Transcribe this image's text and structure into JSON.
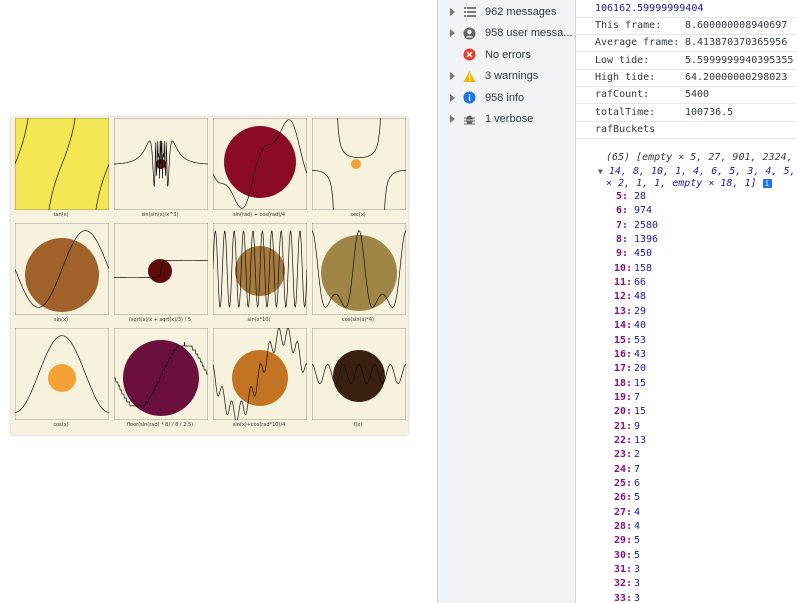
{
  "plots": [
    {
      "caption": "tan(x)",
      "bg": "#f5e654",
      "circle": null
    },
    {
      "caption": "sin(sin(x)/x^3)",
      "bg": "#f6f2dd",
      "circle": "#5a1a10"
    },
    {
      "caption": "sin(rad) + cos(rad)/4",
      "bg": "#f6f2dd",
      "circle": "#8b0a25"
    },
    {
      "caption": "sec(x)",
      "bg": "#f6f2dd",
      "circle": "#f4a235"
    },
    {
      "caption": "sin(x)",
      "bg": "#f6f2dd",
      "circle": "#a0622a"
    },
    {
      "caption": "(sqrt(x)/x + sqrt(x)/3) / 5",
      "bg": "#f6f2dd",
      "circle": "#5f0a0a"
    },
    {
      "caption": "sin(x*10)",
      "bg": "#f6f2dd",
      "circle": "#a57a3c"
    },
    {
      "caption": "cos(sin(x)*4)",
      "bg": "#f6f2dd",
      "circle": "#a08646"
    },
    {
      "caption": "cos(x)",
      "bg": "#f6f2dd",
      "circle": "#f4a235"
    },
    {
      "caption": "floor(sin(rad) * 8) / 8 / 2.5)",
      "bg": "#f6f2dd",
      "circle": "#6b0f3c"
    },
    {
      "caption": "sin(x)+cos(rad*10)/4",
      "bg": "#f6f2dd",
      "circle": "#c27422"
    },
    {
      "caption": "f(x)",
      "bg": "#f6f2dd",
      "circle": "#3a2010"
    }
  ],
  "sidebar": {
    "items": [
      {
        "label": "962 messages",
        "icon": "list-icon"
      },
      {
        "label": "958 user messa...",
        "icon": "user-icon"
      },
      {
        "label": "No errors",
        "icon": "error-icon"
      },
      {
        "label": "3 warnings",
        "icon": "warning-icon"
      },
      {
        "label": "958 info",
        "icon": "info-icon"
      },
      {
        "label": "1 verbose",
        "icon": "bug-icon"
      }
    ]
  },
  "console": {
    "top_value": "106162.59999999404",
    "stats": [
      {
        "key": "This frame:",
        "value": "8.600000008940697"
      },
      {
        "key": "Average frame:",
        "value": "8.413870370365956"
      },
      {
        "key": "Low tide:",
        "value": "5.5999999940395355"
      },
      {
        "key": "High tide:",
        "value": "64.20000000298023"
      },
      {
        "key": "rafCount:",
        "value": "5400"
      },
      {
        "key": "totalTime:",
        "value": "100736.5"
      }
    ],
    "raf_label": "rafBuckets",
    "array_line1": "(65) [empty × 5, 27, 901, 2324, ",
    "array_line2": "14, 8, 10, 1, 4, 6, 5, 3, 4, 5, ",
    "array_line3": "× 2, 1, 1, empty × 18, 1]",
    "info_badge": "i",
    "buckets": [
      {
        "k": "5:",
        "v": "28"
      },
      {
        "k": "6:",
        "v": "974"
      },
      {
        "k": "7:",
        "v": "2580"
      },
      {
        "k": "8:",
        "v": "1396"
      },
      {
        "k": "9:",
        "v": "450"
      },
      {
        "k": "10:",
        "v": "158"
      },
      {
        "k": "11:",
        "v": "66"
      },
      {
        "k": "12:",
        "v": "48"
      },
      {
        "k": "13:",
        "v": "29"
      },
      {
        "k": "14:",
        "v": "40"
      },
      {
        "k": "15:",
        "v": "53"
      },
      {
        "k": "16:",
        "v": "43"
      },
      {
        "k": "17:",
        "v": "20"
      },
      {
        "k": "18:",
        "v": "15"
      },
      {
        "k": "19:",
        "v": "7"
      },
      {
        "k": "20:",
        "v": "15"
      },
      {
        "k": "21:",
        "v": "9"
      },
      {
        "k": "22:",
        "v": "13"
      },
      {
        "k": "23:",
        "v": "2"
      },
      {
        "k": "24:",
        "v": "7"
      },
      {
        "k": "25:",
        "v": "6"
      },
      {
        "k": "26:",
        "v": "5"
      },
      {
        "k": "27:",
        "v": "4"
      },
      {
        "k": "28:",
        "v": "4"
      },
      {
        "k": "29:",
        "v": "5"
      },
      {
        "k": "30:",
        "v": "5"
      },
      {
        "k": "31:",
        "v": "3"
      },
      {
        "k": "32:",
        "v": "3"
      },
      {
        "k": "33:",
        "v": "3"
      }
    ]
  }
}
